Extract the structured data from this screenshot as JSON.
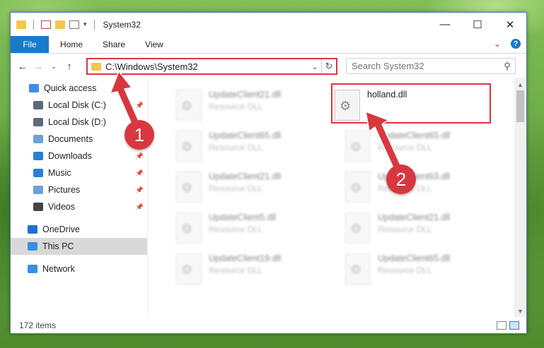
{
  "window": {
    "title": "System32"
  },
  "ribbon": {
    "file_tab": "File",
    "tabs": [
      "Home",
      "Share",
      "View"
    ],
    "help_label": "?"
  },
  "address": {
    "path": "C:\\Windows\\System32",
    "search_placeholder": "Search System32"
  },
  "nav": {
    "items": [
      {
        "label": "Quick access",
        "icon": "star-icon",
        "pinned": false
      },
      {
        "label": "Local Disk (C:)",
        "icon": "drive-icon",
        "pinned": true
      },
      {
        "label": "Local Disk (D:)",
        "icon": "drive-icon",
        "pinned": false
      },
      {
        "label": "Documents",
        "icon": "documents-icon",
        "pinned": true
      },
      {
        "label": "Downloads",
        "icon": "download-icon",
        "pinned": true
      },
      {
        "label": "Music",
        "icon": "music-icon",
        "pinned": true
      },
      {
        "label": "Pictures",
        "icon": "pictures-icon",
        "pinned": true
      },
      {
        "label": "Videos",
        "icon": "videos-icon",
        "pinned": true
      },
      {
        "label": "OneDrive",
        "icon": "cloud-icon",
        "pinned": false
      },
      {
        "label": "This PC",
        "icon": "computer-icon",
        "pinned": false,
        "selected": true
      },
      {
        "label": "Network",
        "icon": "network-icon",
        "pinned": false
      }
    ]
  },
  "files": {
    "left": [
      {
        "name": "UpdateClient21.dll",
        "type": "Resource DLL"
      },
      {
        "name": "UpdateClient65.dll",
        "type": "Resource DLL"
      },
      {
        "name": "UpdateClient21.dll",
        "type": "Resource DLL"
      },
      {
        "name": "UpdateClient5.dll",
        "type": "Resource DLL"
      },
      {
        "name": "UpdateClient19.dll",
        "type": "Resource DLL"
      }
    ],
    "right": [
      {
        "name": "holland.dll",
        "type": ""
      },
      {
        "name": "UpdateClient65.dll",
        "type": "Resource DLL"
      },
      {
        "name": "UpdateClient63.dll",
        "type": "Resource DLL"
      },
      {
        "name": "UpdateClient21.dll",
        "type": "Resource DLL"
      },
      {
        "name": "UpdateClient65.dll",
        "type": "Resource DLL"
      }
    ]
  },
  "status": {
    "item_count": "172 items"
  },
  "annotations": {
    "step1": "1",
    "step2": "2",
    "color": "#d9373f"
  }
}
